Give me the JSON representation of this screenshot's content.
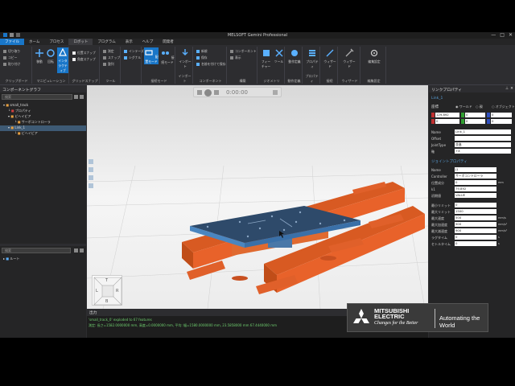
{
  "window": {
    "title": "MELSOFT Gemini Professional",
    "controls": [
      "—",
      "□",
      "✕"
    ]
  },
  "menu": [
    "ファイル",
    "ホーム",
    "プロセス",
    "ロボット",
    "プログラム",
    "表示",
    "ヘルプ",
    "開発者"
  ],
  "ribbon": {
    "groups": [
      {
        "label": "クリップボード",
        "buttons": [
          "切り取り",
          "コピー",
          "貼り付け"
        ]
      },
      {
        "label": "マニピュレーション",
        "buttons": [
          "移動",
          "回転",
          "インタラクティブ"
        ]
      },
      {
        "label": "グリッドスナップ",
        "lines": [
          "位置スナップ",
          "角度スナップ"
        ]
      },
      {
        "label": "ツール",
        "lines": [
          "測定",
          "スナップ",
          "整列"
        ]
      },
      {
        "label": "",
        "lines": [
          "インテーズーム",
          "シグナル"
        ]
      },
      {
        "label": "接続モード",
        "buttons": [
          "配置モード",
          "接続モード"
        ]
      },
      {
        "label": "インポート",
        "buttons": [
          "インポート"
        ]
      },
      {
        "label": "コンポーネント",
        "lines": [
          "新規",
          "保存",
          "名前を付けて保存"
        ]
      },
      {
        "label": "構築",
        "lines": [
          "コンポーネント",
          "表示"
        ]
      },
      {
        "label": "ジオメトリ",
        "buttons": [
          "フィーチャー",
          "ツール"
        ]
      },
      {
        "label": "動作定義",
        "buttons": [
          "動作定義"
        ]
      },
      {
        "label": "プロパティ",
        "buttons": [
          "プロパティ"
        ]
      },
      {
        "label": "接続",
        "buttons": [
          "ウィザード"
        ]
      },
      {
        "label": "ウィザード",
        "buttons": [
          "ウィザード"
        ]
      },
      {
        "label": "編集設定",
        "buttons": [
          "編集設定"
        ]
      }
    ]
  },
  "left_panel": {
    "title": "コンポーネントグラフ",
    "search_placeholder": "検索",
    "tree": [
      "small_track",
      "プロパティ",
      "ビヘイビア",
      "サーボコントローラ",
      "Link_1",
      "ビヘイビア"
    ],
    "bottom_placeholder": "検索",
    "bottom_tree": [
      "ルート"
    ]
  },
  "viewport": {
    "time": "0:00:00",
    "nav": {
      "top": "T",
      "left": "L",
      "right": "R",
      "bottom": "B"
    }
  },
  "output": {
    "title": "出力",
    "lines": [
      "'small_track_0' exploded to 67 features",
      "測定: 長さ=1582.0000000 mm, 高度=0.0000000 mm, 平均: 幅=1580.0000000 mm, 23.5858000 mm 67.4440000 mm"
    ]
  },
  "right_panel": {
    "title": "リンクプロパティ",
    "name_tag": "Link_1",
    "coord_label": "座標",
    "coord_options": [
      "ワールド",
      "親",
      "オブジェクト"
    ],
    "xyz": [
      "129.892",
      "0",
      "0",
      "0",
      "0",
      "0"
    ],
    "props": [
      {
        "k": "Name",
        "v": "Link_1"
      },
      {
        "k": "Offset",
        "v": ""
      },
      {
        "k": "JointType",
        "v": "並進"
      },
      {
        "k": "軸",
        "v": "+X"
      }
    ],
    "joint_section": "ジョイントプロパティ",
    "joint_props": [
      {
        "k": "Name",
        "v": "J1",
        "u": ""
      },
      {
        "k": "Controller",
        "v": "サーボコントローラ",
        "u": ""
      },
      {
        "k": "位置成分",
        "v": "0",
        "u": "mm"
      },
      {
        "k": "k1",
        "v": "79.892",
        "u": ""
      },
      {
        "k": "初期値",
        "v": "VALUE",
        "u": ""
      },
      {
        "k": "最小リミット",
        "v": "0",
        "u": ""
      },
      {
        "k": "最大リミット",
        "v": "1500",
        "u": ""
      },
      {
        "k": "最大速度",
        "v": "500",
        "u": "mm/s"
      },
      {
        "k": "最大加速度",
        "v": "900",
        "u": "mm/s²"
      },
      {
        "k": "最大減速度",
        "v": "900",
        "u": "mm/s²"
      },
      {
        "k": "ラグタイム",
        "v": "0",
        "u": "s"
      },
      {
        "k": "セトルタイム",
        "v": "0",
        "u": "s"
      }
    ]
  },
  "logo": {
    "brand_line1": "MITSUBISHI",
    "brand_line2": "ELECTRIC",
    "slogan": "Changes for the Better",
    "tagline": "Automating the World"
  },
  "colors": {
    "accent": "#1976c8",
    "orange": "#e8622a",
    "plate": "#3a5a7e"
  }
}
